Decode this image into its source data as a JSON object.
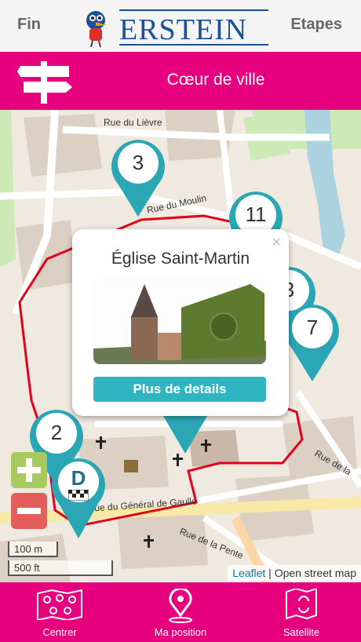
{
  "topbar": {
    "left_button": "Fin",
    "right_button": "Etapes",
    "logo_text": "ERSTEIN"
  },
  "header": {
    "title": "Cœur de ville",
    "icon": "signpost-icon"
  },
  "markers": [
    {
      "label": "3"
    },
    {
      "label": "11"
    },
    {
      "label": "3"
    },
    {
      "label": "7"
    },
    {
      "label": "2"
    },
    {
      "label": "D"
    }
  ],
  "streets": [
    "Rue du Lièvre",
    "Rue du Moulin",
    "Rue du Général de Gaulle",
    "Rue de la Pente",
    "Rue de la"
  ],
  "popup": {
    "title": "Église Saint-Martin",
    "close": "×",
    "button": "Plus de details"
  },
  "zoom": {
    "in": "+",
    "out": "−"
  },
  "scale": {
    "metric": "100 m",
    "imperial": "500 ft"
  },
  "attribution": {
    "link": "Leaflet",
    "separator": " | ",
    "source": "Open street map"
  },
  "footer": {
    "items": [
      {
        "label": "Centrer",
        "icon": "map-pins-icon"
      },
      {
        "label": "Ma position",
        "icon": "location-pin-icon"
      },
      {
        "label": "Satellite",
        "icon": "map-refresh-icon"
      }
    ]
  },
  "colors": {
    "accent": "#e6007e",
    "marker": "#2aa6b5",
    "route": "#e3001b",
    "button": "#2fb4c2"
  }
}
